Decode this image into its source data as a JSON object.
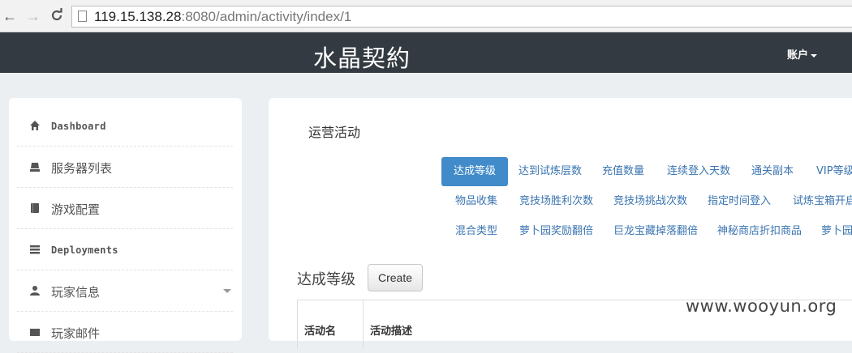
{
  "browser": {
    "url_host": "119.15.138.28",
    "url_rest": ":8080/admin/activity/index/1"
  },
  "navbar": {
    "title": "水晶契約",
    "account_label": "账户"
  },
  "sidebar": {
    "items": [
      {
        "label": "Dashboard",
        "icon": "home-icon"
      },
      {
        "label": "服务器列表",
        "icon": "server-icon"
      },
      {
        "label": "游戏配置",
        "icon": "book-icon"
      },
      {
        "label": "Deployments",
        "icon": "list-icon"
      },
      {
        "label": "玩家信息",
        "icon": "user-icon"
      },
      {
        "label": "玩家邮件",
        "icon": "mail-icon"
      }
    ]
  },
  "main": {
    "section_title": "运营活动",
    "activity_rows": [
      [
        "达成等级",
        "达到试炼层数",
        "充值数量",
        "连续登入天数",
        "通关副本",
        "VIP等级"
      ],
      [
        "物品收集",
        "竞技场胜利次数",
        "竞技场挑战次数",
        "指定时间登入",
        "试炼宝箱开启"
      ],
      [
        "混合类型",
        "萝卜园奖励翻倍",
        "巨龙宝藏掉落翻倍",
        "神秘商店折扣商品",
        "萝卜园"
      ]
    ],
    "active_activity": "达成等级",
    "list_heading": "达成等级",
    "create_label": "Create",
    "table_headers": [
      "活动名",
      "活动描述"
    ]
  },
  "watermark": "www.wooyun.org",
  "colors": {
    "navbar_bg": "#333a41",
    "active_pill": "#428bca",
    "link": "#3a74b0",
    "page_bg": "#eceff2"
  }
}
